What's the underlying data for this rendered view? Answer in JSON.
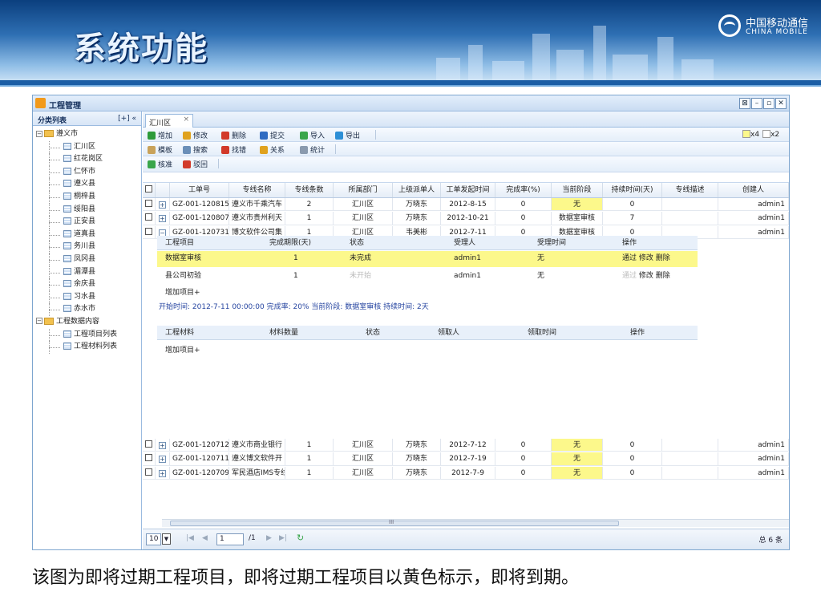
{
  "slide": {
    "title": "系统功能",
    "logo_cn": "中国移动通信",
    "logo_en": "CHINA MOBILE",
    "caption": "该图为即将过期工程项目，即将过期工程项目以黄色标示，即将到期。"
  },
  "window": {
    "title": "工程管理",
    "buttons": [
      "⊠",
      "–",
      "▫",
      "✕"
    ]
  },
  "sidebar": {
    "header": "分类列表",
    "controls": "[+] «",
    "tree": [
      {
        "label": "遵义市",
        "level": 0,
        "type": "folder",
        "toggle": "−"
      },
      {
        "label": "汇川区",
        "level": 1,
        "type": "grid"
      },
      {
        "label": "红花岗区",
        "level": 1,
        "type": "grid"
      },
      {
        "label": "仁怀市",
        "level": 1,
        "type": "grid"
      },
      {
        "label": "遵义县",
        "level": 1,
        "type": "grid"
      },
      {
        "label": "桐梓县",
        "level": 1,
        "type": "grid"
      },
      {
        "label": "绥阳县",
        "level": 1,
        "type": "grid"
      },
      {
        "label": "正安县",
        "level": 1,
        "type": "grid"
      },
      {
        "label": "道真县",
        "level": 1,
        "type": "grid"
      },
      {
        "label": "务川县",
        "level": 1,
        "type": "grid"
      },
      {
        "label": "凤冈县",
        "level": 1,
        "type": "grid"
      },
      {
        "label": "湄潭县",
        "level": 1,
        "type": "grid"
      },
      {
        "label": "余庆县",
        "level": 1,
        "type": "grid"
      },
      {
        "label": "习水县",
        "level": 1,
        "type": "grid"
      },
      {
        "label": "赤水市",
        "level": 1,
        "type": "grid"
      },
      {
        "label": "工程数据内容",
        "level": 0,
        "type": "folder",
        "toggle": "−"
      },
      {
        "label": "工程项目列表",
        "level": 1,
        "type": "grid"
      },
      {
        "label": "工程材料列表",
        "level": 1,
        "type": "grid"
      }
    ]
  },
  "tab": {
    "label": "汇川区",
    "close": "×"
  },
  "toolbar1": [
    {
      "label": "增加",
      "color": "#2e9b3a"
    },
    {
      "label": "修改",
      "color": "#e0a21e"
    },
    {
      "label": "删除",
      "color": "#d23a2a"
    },
    {
      "label": "提交",
      "color": "#2f6cc2"
    },
    {
      "label": "导入",
      "color": "#3aa64b"
    },
    {
      "label": "导出",
      "color": "#2d8fd6"
    }
  ],
  "toolbar2": [
    {
      "label": "模板",
      "color": "#c9a25a"
    },
    {
      "label": "搜索",
      "color": "#6a8fb8"
    },
    {
      "label": "找错",
      "color": "#d23a2a"
    },
    {
      "label": "关系",
      "color": "#e0a21e"
    },
    {
      "label": "统计",
      "color": "#8a9aae"
    }
  ],
  "toolbar3": [
    {
      "label": "核准",
      "color": "#3aa64b"
    },
    {
      "label": "驳回",
      "color": "#d23a2a"
    }
  ],
  "legend": [
    {
      "color": "#fcf88b",
      "label": "x4"
    },
    {
      "color": "#ffffff",
      "label": "x2"
    }
  ],
  "grid": {
    "columns": [
      "",
      "",
      "工单号",
      "专线名称",
      "专线条数",
      "所属部门",
      "上级派单人",
      "工单发起时间",
      "完成率(%)",
      "当前阶段",
      "持续时间(天)",
      "专线描述",
      "创建人"
    ],
    "rows_top": [
      {
        "expand": "+",
        "id": "GZ-001-120815-",
        "name": "遵义市千乘汽车",
        "count": "2",
        "dept": "汇川区",
        "sender": "万晓东",
        "date": "2012-8-15",
        "rate": "0",
        "stage": "无",
        "stage_yellow": true,
        "days": "0",
        "desc": "",
        "creator": "admin1"
      },
      {
        "expand": "+",
        "id": "GZ-001-120807-",
        "name": "遵义市贵州利天",
        "count": "1",
        "dept": "汇川区",
        "sender": "万晓东",
        "date": "2012-10-21",
        "rate": "0",
        "stage": "数据室审核",
        "stage_yellow": false,
        "days": "7",
        "desc": "",
        "creator": "admin1"
      },
      {
        "expand": "−",
        "id": "GZ-001-120731-",
        "name": "博文软件公司集",
        "count": "1",
        "dept": "汇川区",
        "sender": "韦美彬",
        "date": "2012-7-11",
        "rate": "0",
        "stage": "数据室审核",
        "stage_yellow": false,
        "days": "0",
        "desc": "",
        "creator": "admin1"
      }
    ],
    "rows_bottom": [
      {
        "expand": "+",
        "id": "GZ-001-120712-",
        "name": "遵义市商业银行",
        "count": "1",
        "dept": "汇川区",
        "sender": "万晓东",
        "date": "2012-7-12",
        "rate": "0",
        "stage": "无",
        "stage_yellow": true,
        "days": "0",
        "desc": "",
        "creator": "admin1"
      },
      {
        "expand": "+",
        "id": "GZ-001-120711-",
        "name": "遵义博文软件开",
        "count": "1",
        "dept": "汇川区",
        "sender": "万晓东",
        "date": "2012-7-19",
        "rate": "0",
        "stage": "无",
        "stage_yellow": true,
        "days": "0",
        "desc": "",
        "creator": "admin1"
      },
      {
        "expand": "+",
        "id": "GZ-001-120709-",
        "name": "军民酒店IMS专线",
        "count": "1",
        "dept": "汇川区",
        "sender": "万晓东",
        "date": "2012-7-9",
        "rate": "0",
        "stage": "无",
        "stage_yellow": true,
        "days": "0",
        "desc": "",
        "creator": "admin1"
      }
    ]
  },
  "detail": {
    "project_headers": [
      "工程项目",
      "完成期限(天)",
      "状态",
      "受理人",
      "受理时间",
      "操作"
    ],
    "project_rows": [
      {
        "item": "数据室审核",
        "limit": "1",
        "status": "未完成",
        "handler": "admin1",
        "time": "无",
        "ops_pass": "通过",
        "ops_rest": "修改 删除",
        "highlight": true,
        "muted": false
      },
      {
        "item": "县公司初验",
        "limit": "1",
        "status": "未开始",
        "handler": "admin1",
        "time": "无",
        "ops_pass": "通过",
        "ops_rest": "修改 删除",
        "highlight": false,
        "muted": true
      }
    ],
    "add_project": "增加项目+",
    "info": "开始时间: 2012-7-11 00:00:00  完成率: 20%  当前阶段: 数据室审核  持续时间: 2天",
    "material_headers": [
      "工程材料",
      "材料数量",
      "状态",
      "领取人",
      "领取时间",
      "操作"
    ],
    "add_material": "增加项目+"
  },
  "pager": {
    "page_size": "10",
    "current": "1",
    "total_pages": "/1",
    "total": "总 6 条",
    "scroll_mark": "III"
  },
  "colors": {
    "highlight": "#fcf88b",
    "accent": "#1b5ea5",
    "border": "#9bbbe0"
  }
}
